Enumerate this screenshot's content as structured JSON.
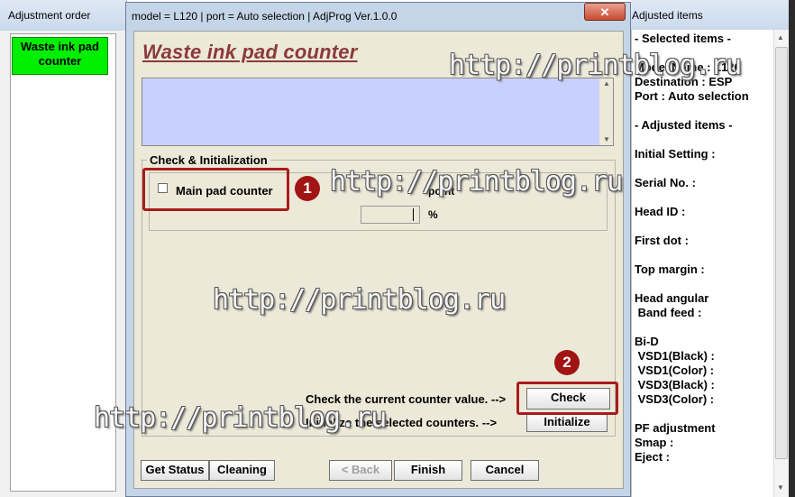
{
  "left_window": {
    "title": "Adjustment order",
    "item_line1": "Waste ink pad",
    "item_line2": "counter"
  },
  "right_window": {
    "title": "Adjusted items",
    "lines": [
      "- Selected items -",
      "Model Name : L120",
      "Destination : ESP",
      "Port : Auto selection",
      "- Adjusted items -",
      "Initial Setting :",
      "Serial No. :",
      "Head ID :",
      "First dot :",
      "Top margin :",
      "Head angular",
      " Band feed :",
      "Bi-D",
      " VSD1(Black) :",
      " VSD1(Color) :",
      " VSD3(Black) :",
      " VSD3(Color) :",
      "PF adjustment",
      "Smap :",
      "Eject :"
    ]
  },
  "dialog": {
    "title": "model = L120 | port = Auto selection | AdjProg Ver.1.0.0",
    "close_glyph": "✕",
    "heading": "Waste ink pad counter",
    "group_label": "Check & Initialization",
    "checkbox_label": "Main pad counter",
    "checkbox_checked": false,
    "point_label": "point",
    "percent_label": "%",
    "check_prompt": "Check the current counter value. -->",
    "init_prompt": "Initialize the selected counters. -->",
    "check_button": "Check",
    "initialize_button": "Initialize",
    "get_status_button": "Get Status",
    "cleaning_button": "Cleaning",
    "back_button": "< Back",
    "finish_button": "Finish",
    "cancel_button": "Cancel"
  },
  "annotations": {
    "badge1": "1",
    "badge2": "2",
    "highlight_color": "#a81c1c"
  },
  "watermark": "http://printblog.ru"
}
